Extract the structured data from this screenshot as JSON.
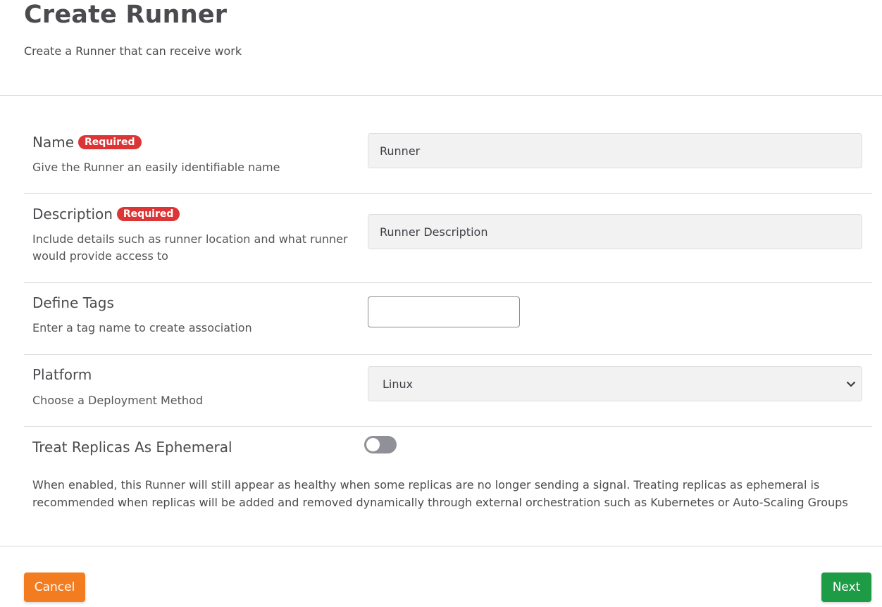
{
  "header": {
    "title": "Create Runner",
    "subtitle": "Create a Runner that can receive work"
  },
  "fields": {
    "name": {
      "label": "Name",
      "badge": "Required",
      "help": "Give the Runner an easily identifiable name",
      "value": "Runner"
    },
    "description": {
      "label": "Description",
      "badge": "Required",
      "help": "Include details such as runner location and what runner would provide access to",
      "value": "Runner Description"
    },
    "tags": {
      "label": "Define Tags",
      "help": "Enter a tag name to create association",
      "value": ""
    },
    "platform": {
      "label": "Platform",
      "help": "Choose a Deployment Method",
      "selected": "Linux"
    },
    "ephemeral": {
      "label": "Treat Replicas As Ephemeral",
      "enabled": false,
      "help": "When enabled, this Runner will still appear as healthy when some replicas are no longer sending a signal. Treating replicas as ephemeral is recommended when replicas will be added and removed dynamically through external orchestration such as Kubernetes or Auto-Scaling Groups"
    }
  },
  "actions": {
    "cancel_label": "Cancel",
    "next_label": "Next"
  },
  "colors": {
    "required_badge": "#dc3535",
    "cancel_button": "#f47c20",
    "next_button": "#1e9b45",
    "toggle_off": "#909098"
  },
  "icons": {
    "platform_dropdown": "chevron-down-icon"
  }
}
